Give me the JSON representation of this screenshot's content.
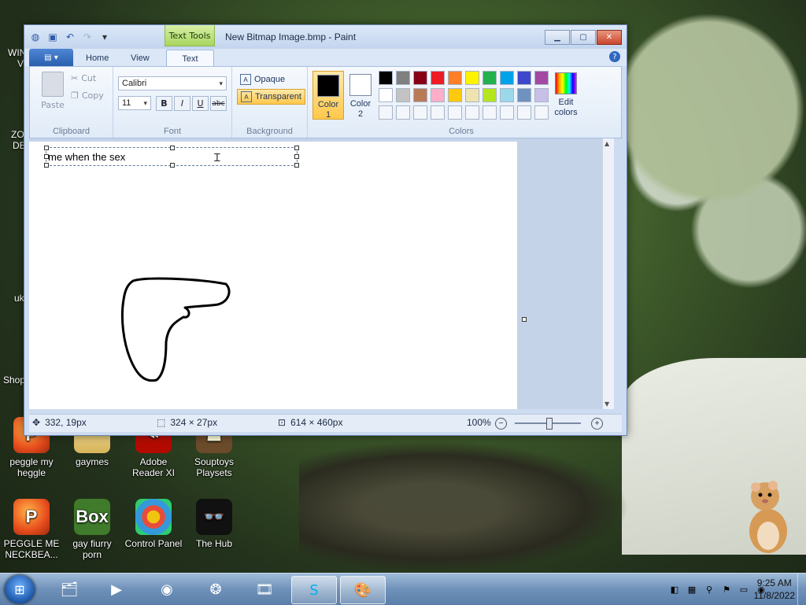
{
  "window": {
    "title": "New Bitmap Image.bmp - Paint",
    "context_tab": "Text Tools"
  },
  "tabs": [
    {
      "label": "Home"
    },
    {
      "label": "View"
    },
    {
      "label": "Text"
    }
  ],
  "clipboard": {
    "paste": "Paste",
    "cut": "Cut",
    "copy": "Copy",
    "group": "Clipboard"
  },
  "font": {
    "family": "Calibri",
    "size": "11",
    "bold": "B",
    "italic": "I",
    "underline": "U",
    "strike": "abc",
    "group": "Font"
  },
  "background": {
    "opaque": "Opaque",
    "transparent": "Transparent",
    "group": "Background"
  },
  "colors": {
    "color1_label": "Color",
    "color1_num": "1",
    "color2_label": "Color",
    "color2_num": "2",
    "edit_label": "Edit",
    "edit_label2": "colors",
    "group": "Colors",
    "color1": "#000000",
    "color2": "#ffffff",
    "palette_row1": [
      "#000000",
      "#7f7f7f",
      "#880015",
      "#ed1c24",
      "#ff7f27",
      "#fff200",
      "#22b14c",
      "#00a2e8",
      "#3f48cc",
      "#a349a4"
    ],
    "palette_row2": [
      "#ffffff",
      "#c3c3c3",
      "#b97a57",
      "#ffaec9",
      "#ffc90e",
      "#efe4b0",
      "#b5e61d",
      "#99d9ea",
      "#7092be",
      "#c8bfe7"
    ]
  },
  "canvas": {
    "text": "me when the sex"
  },
  "status": {
    "cursor": "332, 19px",
    "selection": "324 × 27px",
    "size": "614 × 460px",
    "zoom": "100%"
  },
  "desktop_icons": [
    {
      "label": "peggle my heggle",
      "icon": "peggle-icon"
    },
    {
      "label": "gaymes",
      "icon": "folder-icon"
    },
    {
      "label": "Adobe Reader XI",
      "icon": "adobe-reader-icon"
    },
    {
      "label": "Souptoys Playsets",
      "icon": "souptoys-icon"
    },
    {
      "label": "PEGGLE ME NECKBEA...",
      "icon": "peggle-icon"
    },
    {
      "label": "gay fiurry porn",
      "icon": "box-icon"
    },
    {
      "label": "Control Panel",
      "icon": "control-panel-icon"
    },
    {
      "label": "The Hub",
      "icon": "hub-icon"
    }
  ],
  "edge_labels": [
    "WIN",
    "V",
    "ZO",
    "DE",
    "uk",
    "Shop"
  ],
  "box_text": "Box",
  "taskbar": {
    "time": "9:25 AM",
    "date": "11/8/2022"
  }
}
